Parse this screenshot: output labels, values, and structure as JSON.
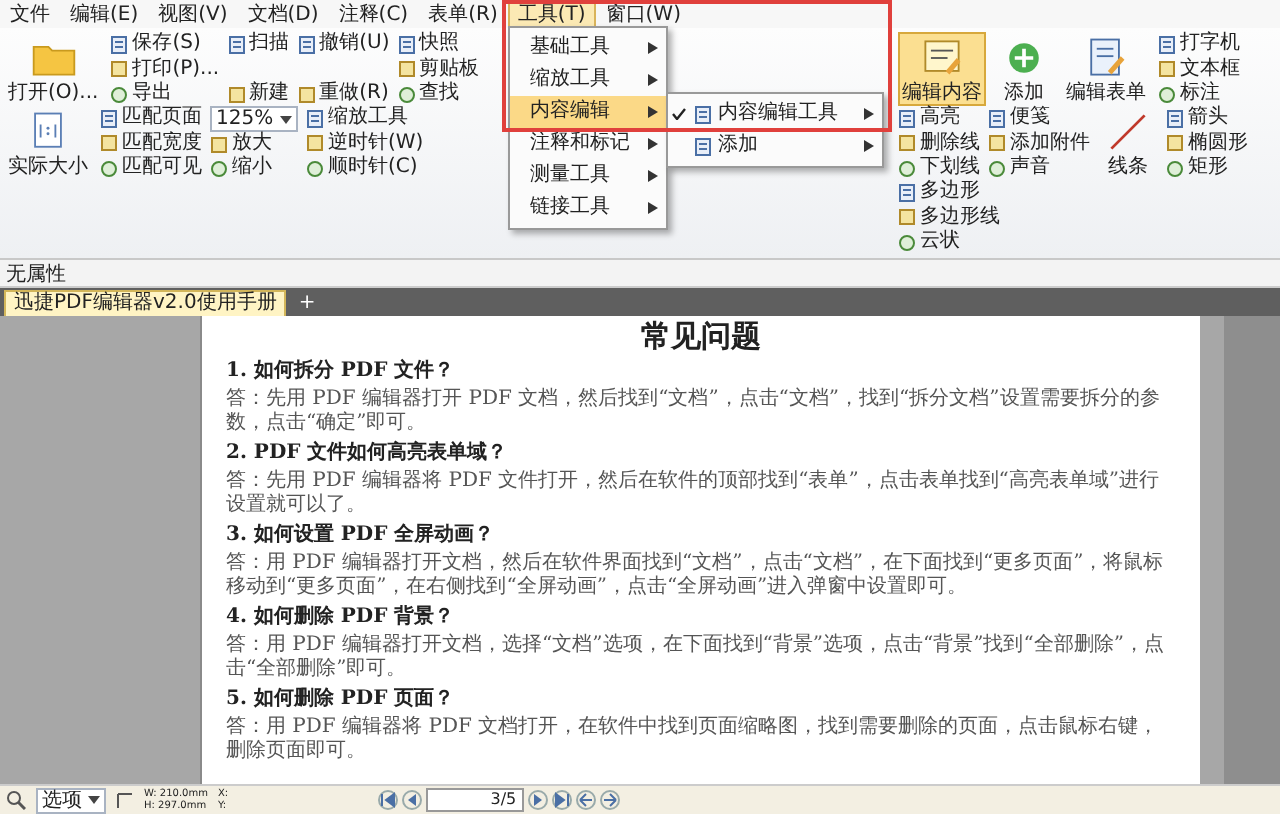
{
  "menubar": [
    {
      "label": "文件",
      "selected": false
    },
    {
      "label": "编辑(E)",
      "selected": false
    },
    {
      "label": "视图(V)",
      "selected": false
    },
    {
      "label": "文档(D)",
      "selected": false
    },
    {
      "label": "注释(C)",
      "selected": false
    },
    {
      "label": "表单(R)",
      "selected": false
    },
    {
      "label": "工具(T)",
      "selected": true
    },
    {
      "label": "窗口(W)",
      "selected": false
    }
  ],
  "tools_menu": {
    "items": [
      {
        "label": "基础工具",
        "selected": false
      },
      {
        "label": "缩放工具",
        "selected": false
      },
      {
        "label": "内容编辑",
        "selected": true
      },
      {
        "label": "注释和标记",
        "selected": false
      },
      {
        "label": "测量工具",
        "selected": false
      },
      {
        "label": "链接工具",
        "selected": false
      }
    ],
    "submenu": [
      {
        "label": "内容编辑工具",
        "checked": true
      },
      {
        "label": "添加",
        "checked": false
      }
    ]
  },
  "red_frame": true,
  "ribbon": {
    "left": [
      {
        "kind": "large",
        "label": "打开(O)..."
      },
      {
        "kind": "stack",
        "items": [
          {
            "label": "保存(S)"
          },
          {
            "label": "打印(P)..."
          },
          {
            "label": "导出"
          }
        ]
      },
      {
        "kind": "stack",
        "items": [
          {
            "label": "扫描"
          },
          {
            "label": "新建"
          }
        ]
      },
      {
        "kind": "stack",
        "items": [
          {
            "label": "撤销(U)"
          },
          {
            "label": "重做(R)"
          }
        ]
      },
      {
        "kind": "stack",
        "items": [
          {
            "label": "快照"
          },
          {
            "label": "剪贴板"
          },
          {
            "label": "查找"
          }
        ]
      },
      {
        "kind": "large",
        "label": "实际大小"
      },
      {
        "kind": "stack",
        "items": [
          {
            "label": "匹配页面"
          },
          {
            "label": "匹配宽度"
          },
          {
            "label": "匹配可见"
          }
        ]
      },
      {
        "kind": "stack",
        "items": [
          {
            "kind": "combo",
            "label": "125%"
          },
          {
            "label": "放大"
          },
          {
            "label": "缩小"
          }
        ]
      },
      {
        "kind": "stack",
        "items": [
          {
            "label": "缩放工具"
          },
          {
            "label": "逆时针(W)"
          },
          {
            "label": "顺时针(C)"
          }
        ]
      }
    ],
    "right": [
      {
        "kind": "large",
        "label": "编辑内容",
        "selected": true
      },
      {
        "kind": "large",
        "label": "添加",
        "selected": false
      },
      {
        "kind": "large",
        "label": "编辑表单",
        "selected": false
      },
      {
        "kind": "stack",
        "items": [
          {
            "label": "打字机"
          },
          {
            "label": "文本框"
          },
          {
            "label": "标注"
          }
        ]
      },
      {
        "kind": "stack",
        "items": [
          {
            "label": "高亮"
          },
          {
            "label": "删除线"
          },
          {
            "label": "下划线"
          }
        ]
      },
      {
        "kind": "stack",
        "items": [
          {
            "label": "便笺"
          },
          {
            "label": "添加附件"
          },
          {
            "label": "声音"
          }
        ]
      },
      {
        "kind": "large",
        "label": "线条",
        "selected": false
      },
      {
        "kind": "stack",
        "items": [
          {
            "label": "箭头"
          },
          {
            "label": "椭圆形"
          },
          {
            "label": "矩形"
          }
        ]
      },
      {
        "kind": "stack",
        "items": [
          {
            "label": "多边形"
          },
          {
            "label": "多边形线"
          },
          {
            "label": "云状"
          }
        ]
      }
    ]
  },
  "properties_bar": {
    "label": "无属性"
  },
  "tabs": [
    {
      "label": "迅捷PDF编辑器v2.0使用手册",
      "selected": true
    }
  ],
  "new_tab": "+",
  "document": {
    "title": "常见问题",
    "sections": [
      {
        "heading": "1. 如何拆分 PDF 文件？",
        "answer": "答：先用 PDF 编辑器打开 PDF 文档，然后找到“文档”，点击“文档”，找到“拆分文档”设置需要拆分的参数，点击“确定”即可。"
      },
      {
        "heading": "2. PDF 文件如何高亮表单域？",
        "answer": "答：先用 PDF 编辑器将 PDF 文件打开，然后在软件的顶部找到“表单”，点击表单找到“高亮表单域”进行设置就可以了。"
      },
      {
        "heading": "3. 如何设置 PDF 全屏动画？",
        "answer": "答：用 PDF 编辑器打开文档，然后在软件界面找到“文档”，点击“文档”，在下面找到“更多页面”，将鼠标移动到“更多页面”，在右侧找到“全屏动画”，点击“全屏动画”进入弹窗中设置即可。"
      },
      {
        "heading": "4. 如何删除 PDF 背景？",
        "answer": "答：用 PDF 编辑器打开文档，选择“文档”选项，在下面找到“背景”选项，点击“背景”找到“全部删除”，点击“全部删除”即可。"
      },
      {
        "heading": "5. 如何删除 PDF 页面？",
        "answer": "答：用 PDF 编辑器将 PDF 文档打开，在软件中找到页面缩略图，找到需要删除的页面，点击鼠标右键，删除页面即可。"
      }
    ]
  },
  "status_bar": {
    "view_option": "选项",
    "width": "W: 210.0mm",
    "height": "H: 297.0mm",
    "x": "X:",
    "y": "Y:",
    "page": "3/5"
  }
}
